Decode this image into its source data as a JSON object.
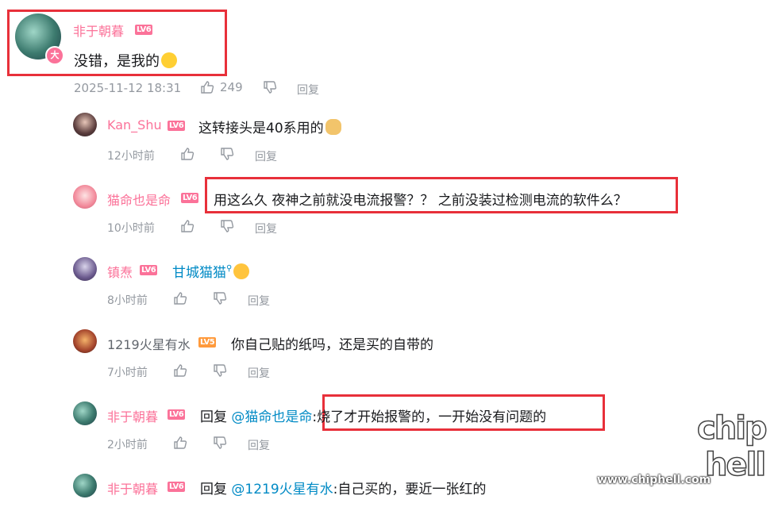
{
  "main": {
    "author": "非于朝暮",
    "author_level": "LV6",
    "author_badge": "大",
    "text": "没错，是我的",
    "time": "2025-11-12 18:31",
    "likes": "249",
    "reply_label": "回复"
  },
  "replies": [
    {
      "user": "Kan_Shu",
      "level": "LV6",
      "text": "这转接头是40系用的",
      "time": "12小时前",
      "reply_label": "回复"
    },
    {
      "user": "猫命也是命",
      "level": "LV6",
      "text": "用这么久 夜神之前就没电流报警？？ 之前没装过检测电流的软件么？",
      "time": "10小时前",
      "reply_label": "回复"
    },
    {
      "user": "镇焘",
      "level": "LV6",
      "text": "甘城猫猫",
      "time": "8小时前",
      "reply_label": "回复"
    },
    {
      "user": "1219火星有水",
      "level": "LV5",
      "text": "你自己贴的纸吗，还是买的自带的",
      "time": "7小时前",
      "reply_label": "回复"
    },
    {
      "user": "非于朝暮",
      "level": "LV6",
      "prefix": "回复",
      "mention": "@猫命也是命",
      "text": ":烧了才开始报警的，一开始没有问题的",
      "time": "2小时前",
      "reply_label": "回复"
    },
    {
      "user": "非于朝暮",
      "level": "LV6",
      "prefix": "回复",
      "mention": "@1219火星有水",
      "text": ":自己买的，要近一张红的"
    }
  ],
  "watermark": {
    "site": "www.chiphell.com",
    "logo_top": "chip",
    "logo_bottom": "hell"
  },
  "colors": {
    "username_pink": "#fb7299",
    "mention_blue": "#008ac5",
    "meta_gray": "#9499a0",
    "highlight_red": "#e8303a"
  }
}
